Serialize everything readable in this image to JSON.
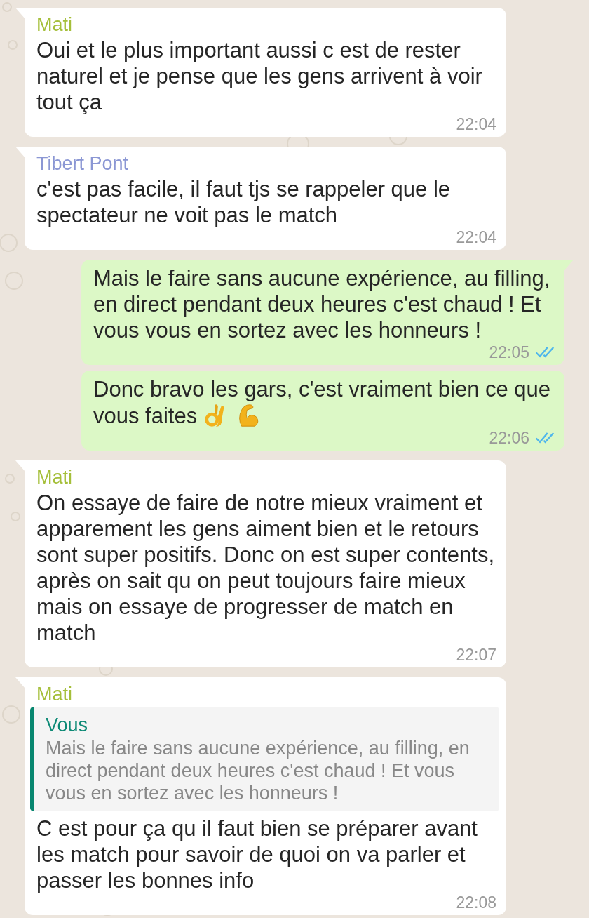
{
  "messages": [
    {
      "kind": "incoming",
      "sender": "Mati",
      "color": "#a5bf3a",
      "text": "Oui et le plus important aussi c est de rester naturel et je pense que les gens arrivent à voir tout ça",
      "time": "22:04",
      "tail": true
    },
    {
      "kind": "incoming",
      "sender": "Tibert Pont",
      "color": "#8b97d4",
      "text": "c'est pas facile, il faut tjs se rappeler que le spectateur ne voit pas le match",
      "time": "22:04",
      "tail": true
    },
    {
      "kind": "outgoing",
      "text": "Mais le faire sans aucune expérience, au filling, en direct pendant deux heures c'est chaud ! Et vous vous en sortez avec les honneurs !",
      "time": "22:05",
      "read": true,
      "tail": true
    },
    {
      "kind": "outgoing",
      "text": "Donc bravo les gars, c'est vraiment bien ce que vous faites",
      "emojis": [
        {
          "kind": "ok-hand"
        },
        {
          "kind": "flexed-arm"
        }
      ],
      "time": "22:06",
      "read": true,
      "tail": false
    },
    {
      "kind": "incoming",
      "sender": "Mati",
      "color": "#a5bf3a",
      "text": "On essaye de faire de notre mieux vraiment et apparement les gens aiment bien et le retours sont super positifs. Donc on est super contents, après on sait qu on peut toujours faire mieux mais on essaye de progresser de match en match",
      "time": "22:07",
      "tail": true
    },
    {
      "kind": "incoming",
      "sender": "Mati",
      "color": "#a5bf3a",
      "quote": {
        "author": "Vous",
        "text": "Mais le faire sans aucune expérience, au filling, en direct pendant deux heures c'est chaud ! Et vous vous en sortez avec les honneurs !"
      },
      "text": "C est pour ça qu il faut bien se préparer avant les match pour savoir de quoi on va parler et passer les bonnes info",
      "time": "22:08",
      "tail": true
    }
  ]
}
